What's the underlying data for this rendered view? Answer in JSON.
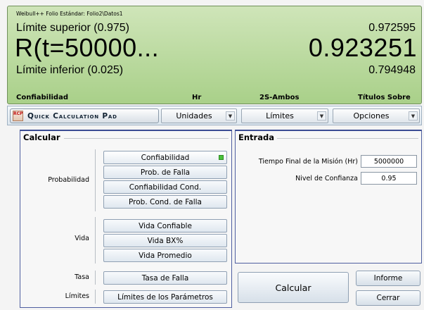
{
  "display": {
    "path": "Weibull++ Folio Estándar: Folio2\\Datos1",
    "upper_label": "Límite superior (0.975)",
    "upper_value": "0.972595",
    "main_label": "R(t=50000...",
    "main_value": "0.923251",
    "lower_label": "Límite inferior (0.025)",
    "lower_value": "0.794948",
    "status": {
      "metric": "Confiabilidad",
      "unit": "Hr",
      "bounds": "2S-Ambos",
      "titles": "Títulos Sobre"
    }
  },
  "toolbar": {
    "qcp_icon": "RCP",
    "qcp_label": "Quick Calculation Pad",
    "units": "Unidades",
    "bounds": "Límites",
    "options": "Opciones"
  },
  "calcular": {
    "title": "Calcular",
    "rows": {
      "probabilidad": "Probabilidad",
      "vida": "Vida",
      "tasa": "Tasa",
      "limites": "Límites"
    },
    "buttons": {
      "confiabilidad": "Confiabilidad",
      "prob_falla": "Prob. de Falla",
      "confiabilidad_cond": "Confiabilidad Cond.",
      "prob_cond_falla": "Prob. Cond. de Falla",
      "vida_confiable": "Vida Confiable",
      "vida_bx": "Vida BX%",
      "vida_promedio": "Vida Promedio",
      "tasa_falla": "Tasa de Falla",
      "limites_parametros": "Límites de los Parámetros"
    }
  },
  "entrada": {
    "title": "Entrada",
    "mission_time_label": "Tiempo Final de la Misión (Hr)",
    "mission_time_value": "5000000",
    "confidence_label": "Nivel de Confianza",
    "confidence_value": "0.95"
  },
  "actions": {
    "calcular": "Calcular",
    "informe": "Informe",
    "cerrar": "Cerrar"
  },
  "colors": {
    "display_bg": "#b8d99b",
    "group_border": "#3b4c94",
    "active_indicator": "#49c23a"
  }
}
